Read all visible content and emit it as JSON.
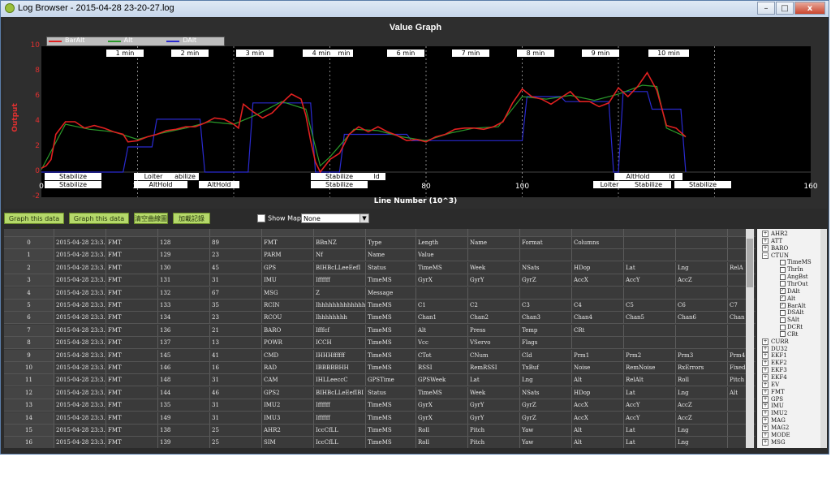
{
  "window": {
    "title": "Log Browser - 2015-04-28 23-20-27.log",
    "btn_min": "–",
    "btn_max": "□",
    "btn_close": "x"
  },
  "graph": {
    "title": "Value Graph",
    "ylabel": "Output",
    "xlabel": "Line Number (10^3)",
    "yticks": [
      "10",
      "8",
      "6",
      "4",
      "2",
      "0",
      "-2"
    ],
    "xticks": [
      "0",
      "20",
      "40",
      "60",
      "80",
      "100",
      "120",
      "140",
      "160"
    ],
    "legend": [
      {
        "name": "BarAlt",
        "color": "#e02020"
      },
      {
        "name": "Alt",
        "color": "#2a9a2a"
      },
      {
        "name": "DAlt",
        "color": "#2a2ad0"
      }
    ],
    "time_markers": [
      "1 min",
      "2 min",
      "3 min",
      "4 min",
      "min",
      "6 min",
      "7 min",
      "8 min",
      "9 min",
      "10 min"
    ],
    "mode_top": [
      "Stabilize",
      "Loiter",
      "abilize",
      "Stabilize",
      "ld",
      "AltHold",
      "ld"
    ],
    "mode_bottom": [
      "Stabilize",
      "AltHold",
      "AltHold",
      "Stabilize",
      "Loiter",
      "Stabilize",
      "Stabilize"
    ]
  },
  "chart_data": {
    "type": "line",
    "title": "Value Graph",
    "xlabel": "Line Number (10^3)",
    "ylabel": "Output",
    "xlim": [
      0,
      160
    ],
    "ylim": [
      -2,
      10
    ],
    "grid": false,
    "legend_position": "top-left",
    "series": [
      {
        "name": "BarAlt",
        "x": [
          0,
          1,
          2,
          3,
          5,
          7,
          9,
          11,
          13,
          15,
          17,
          18,
          20,
          22,
          24,
          26,
          28,
          30,
          32,
          34,
          36,
          38,
          40,
          41,
          42,
          44,
          46,
          48,
          50,
          52,
          54,
          55,
          56,
          57,
          58,
          60,
          62,
          64,
          66,
          68,
          70,
          72,
          74,
          76,
          78,
          80,
          82,
          84,
          86,
          88,
          90,
          92,
          94,
          96,
          98,
          100,
          102,
          104,
          106,
          108,
          110,
          112,
          114,
          116,
          118,
          120,
          122,
          124,
          126,
          128,
          130,
          132,
          134
        ],
        "y": [
          0.3,
          0.5,
          1,
          3,
          4,
          4,
          3.5,
          3.7,
          3.5,
          3.2,
          3,
          2.4,
          2.5,
          2.8,
          3,
          3.3,
          3.4,
          3.6,
          3.6,
          3.9,
          4.3,
          4.2,
          3.8,
          3.5,
          5.4,
          4.8,
          4.3,
          4.7,
          5.5,
          6.2,
          5.8,
          4.5,
          2.5,
          0.8,
          0,
          1,
          1.5,
          3,
          3.6,
          3.2,
          3.6,
          3.2,
          2.9,
          2.5,
          2.6,
          2.4,
          2.8,
          3,
          3.4,
          3.5,
          3.5,
          3.4,
          3.6,
          4,
          5.5,
          6.6,
          6,
          5.8,
          5.4,
          5.9,
          6.4,
          5.6,
          5.6,
          5.2,
          5.5,
          6.7,
          6,
          6.8,
          7.9,
          6.5,
          3.7,
          3.5,
          2.8
        ]
      },
      {
        "name": "Alt",
        "x": [
          0,
          5,
          10,
          15,
          20,
          25,
          30,
          35,
          40,
          45,
          50,
          55,
          58,
          60,
          65,
          70,
          75,
          80,
          85,
          90,
          95,
          100,
          105,
          110,
          115,
          120,
          125,
          128,
          130,
          134
        ],
        "y": [
          0.2,
          3.8,
          3.4,
          3.2,
          2.6,
          3.1,
          3.5,
          4,
          3.8,
          4.6,
          5.6,
          5,
          0.5,
          1.2,
          3.4,
          3.3,
          2.8,
          2.5,
          3.1,
          3.5,
          3.6,
          6,
          5.8,
          6.1,
          5.7,
          6.2,
          6.9,
          6.8,
          3.5,
          2.8
        ]
      },
      {
        "name": "DAlt",
        "x": [
          0,
          1,
          17,
          18,
          23,
          24,
          33,
          34,
          43,
          44,
          56,
          57,
          62,
          63,
          76,
          77,
          100,
          101,
          108,
          109,
          118,
          119,
          120,
          121,
          126,
          127,
          133,
          134
        ],
        "y": [
          0,
          0,
          0,
          2,
          2,
          4.2,
          4.2,
          0,
          0,
          5.5,
          5.5,
          0,
          0,
          3,
          3,
          2.5,
          2.5,
          6,
          6,
          5.6,
          5.6,
          0,
          0,
          6.4,
          6.4,
          5,
          5,
          0
        ]
      }
    ]
  },
  "toolbar": {
    "graph_left": "Graph this data Left",
    "graph_right": "Graph this data Right",
    "clear": "清空曲線圖",
    "load": "加載記錄",
    "show_map": "Show Map",
    "map_select": "None"
  },
  "table": {
    "rows": [
      [
        "0",
        "2015-04-28 23:3...",
        "FMT",
        "128",
        "89",
        "FMT",
        "BBnNZ",
        "Type",
        "Length",
        "Name",
        "Format",
        "Columns",
        "",
        "",
        ""
      ],
      [
        "1",
        "2015-04-28 23:3...",
        "FMT",
        "129",
        "23",
        "PARM",
        "Nf",
        "Name",
        "Value",
        "",
        "",
        "",
        "",
        "",
        ""
      ],
      [
        "2",
        "2015-04-28 23:3...",
        "FMT",
        "130",
        "45",
        "GPS",
        "BIHBcLLeeEefI",
        "Status",
        "TimeMS",
        "Week",
        "NSats",
        "HDop",
        "Lat",
        "Lng",
        "RelA"
      ],
      [
        "3",
        "2015-04-28 23:3...",
        "FMT",
        "131",
        "31",
        "IMU",
        "Iffffff",
        "TimeMS",
        "GyrX",
        "GyrY",
        "GyrZ",
        "AccX",
        "AccY",
        "AccZ",
        ""
      ],
      [
        "4",
        "2015-04-28 23:3...",
        "FMT",
        "132",
        "67",
        "MSG",
        "Z",
        "Message",
        "",
        "",
        "",
        "",
        "",
        "",
        ""
      ],
      [
        "5",
        "2015-04-28 23:3...",
        "FMT",
        "133",
        "35",
        "RCIN",
        "Ihhhhhhhhhhhhhh",
        "TimeMS",
        "C1",
        "C2",
        "C3",
        "C4",
        "C5",
        "C6",
        "C7"
      ],
      [
        "6",
        "2015-04-28 23:3...",
        "FMT",
        "134",
        "23",
        "RCOU",
        "Ihhhhhhhh",
        "TimeMS",
        "Chan1",
        "Chan2",
        "Chan3",
        "Chan4",
        "Chan5",
        "Chan6",
        "Chan"
      ],
      [
        "7",
        "2015-04-28 23:3...",
        "FMT",
        "136",
        "21",
        "BARO",
        "Ifffcf",
        "TimeMS",
        "Alt",
        "Press",
        "Temp",
        "CRt",
        "",
        "",
        ""
      ],
      [
        "8",
        "2015-04-28 23:3...",
        "FMT",
        "137",
        "13",
        "POWR",
        "ICCH",
        "TimeMS",
        "Vcc",
        "VServo",
        "Flags",
        "",
        "",
        "",
        ""
      ],
      [
        "9",
        "2015-04-28 23:3...",
        "FMT",
        "145",
        "41",
        "CMD",
        "IHHHffffff",
        "TimeMS",
        "CTot",
        "CNum",
        "CId",
        "Prm1",
        "Prm2",
        "Prm3",
        "Prm4"
      ],
      [
        "10",
        "2015-04-28 23:3...",
        "FMT",
        "146",
        "16",
        "RAD",
        "IBBBBBHH",
        "TimeMS",
        "RSSI",
        "RemRSSI",
        "TxBuf",
        "Noise",
        "RemNoise",
        "RxErrors",
        "Fixed"
      ],
      [
        "11",
        "2015-04-28 23:3...",
        "FMT",
        "148",
        "31",
        "CAM",
        "IHLLeeccC",
        "GPSTime",
        "GPSWeek",
        "Lat",
        "Lng",
        "Alt",
        "RelAlt",
        "Roll",
        "Pitch"
      ],
      [
        "12",
        "2015-04-28 23:3...",
        "FMT",
        "144",
        "46",
        "GPS2",
        "BIHBcLLeEefIBI",
        "Status",
        "TimeMS",
        "Week",
        "NSats",
        "HDop",
        "Lat",
        "Lng",
        "Alt"
      ],
      [
        "13",
        "2015-04-28 23:3...",
        "FMT",
        "135",
        "31",
        "IMU2",
        "Iffffff",
        "TimeMS",
        "GyrX",
        "GyrY",
        "GyrZ",
        "AccX",
        "AccY",
        "AccZ",
        ""
      ],
      [
        "14",
        "2015-04-28 23:3...",
        "FMT",
        "149",
        "31",
        "IMU3",
        "Iffffff",
        "TimeMS",
        "GyrX",
        "GyrY",
        "GyrZ",
        "AccX",
        "AccY",
        "AccZ",
        ""
      ],
      [
        "15",
        "2015-04-28 23:3...",
        "FMT",
        "138",
        "25",
        "AHR2",
        "IccCfLL",
        "TimeMS",
        "Roll",
        "Pitch",
        "Yaw",
        "Alt",
        "Lat",
        "Lng",
        ""
      ],
      [
        "16",
        "2015-04-28 23:3...",
        "FMT",
        "139",
        "25",
        "SIM",
        "IccCfLL",
        "TimeMS",
        "Roll",
        "Pitch",
        "Yaw",
        "Alt",
        "Lat",
        "Lng",
        ""
      ]
    ]
  },
  "tree": {
    "items": [
      {
        "label": "AHR2",
        "kind": "group"
      },
      {
        "label": "ATT",
        "kind": "group"
      },
      {
        "label": "BARO",
        "kind": "group"
      },
      {
        "label": "CTUN",
        "kind": "open"
      },
      {
        "label": "TimeMS",
        "kind": "leaf",
        "checked": false
      },
      {
        "label": "ThrIn",
        "kind": "leaf",
        "checked": false
      },
      {
        "label": "AngBst",
        "kind": "leaf",
        "checked": false
      },
      {
        "label": "ThrOut",
        "kind": "leaf",
        "checked": false
      },
      {
        "label": "DAlt",
        "kind": "leaf",
        "checked": true
      },
      {
        "label": "Alt",
        "kind": "leaf",
        "checked": true
      },
      {
        "label": "BarAlt",
        "kind": "leaf",
        "checked": true
      },
      {
        "label": "DSAlt",
        "kind": "leaf",
        "checked": false
      },
      {
        "label": "SAlt",
        "kind": "leaf",
        "checked": false
      },
      {
        "label": "DCRt",
        "kind": "leaf",
        "checked": false
      },
      {
        "label": "CRt",
        "kind": "leaf",
        "checked": false
      },
      {
        "label": "CURR",
        "kind": "group"
      },
      {
        "label": "DU32",
        "kind": "group"
      },
      {
        "label": "EKF1",
        "kind": "group"
      },
      {
        "label": "EKF2",
        "kind": "group"
      },
      {
        "label": "EKF3",
        "kind": "group"
      },
      {
        "label": "EKF4",
        "kind": "group"
      },
      {
        "label": "EV",
        "kind": "group"
      },
      {
        "label": "FMT",
        "kind": "group"
      },
      {
        "label": "GPS",
        "kind": "group"
      },
      {
        "label": "IMU",
        "kind": "group"
      },
      {
        "label": "IMU2",
        "kind": "group"
      },
      {
        "label": "MAG",
        "kind": "group"
      },
      {
        "label": "MAG2",
        "kind": "group"
      },
      {
        "label": "MODE",
        "kind": "group"
      },
      {
        "label": "MSG",
        "kind": "group"
      }
    ]
  }
}
